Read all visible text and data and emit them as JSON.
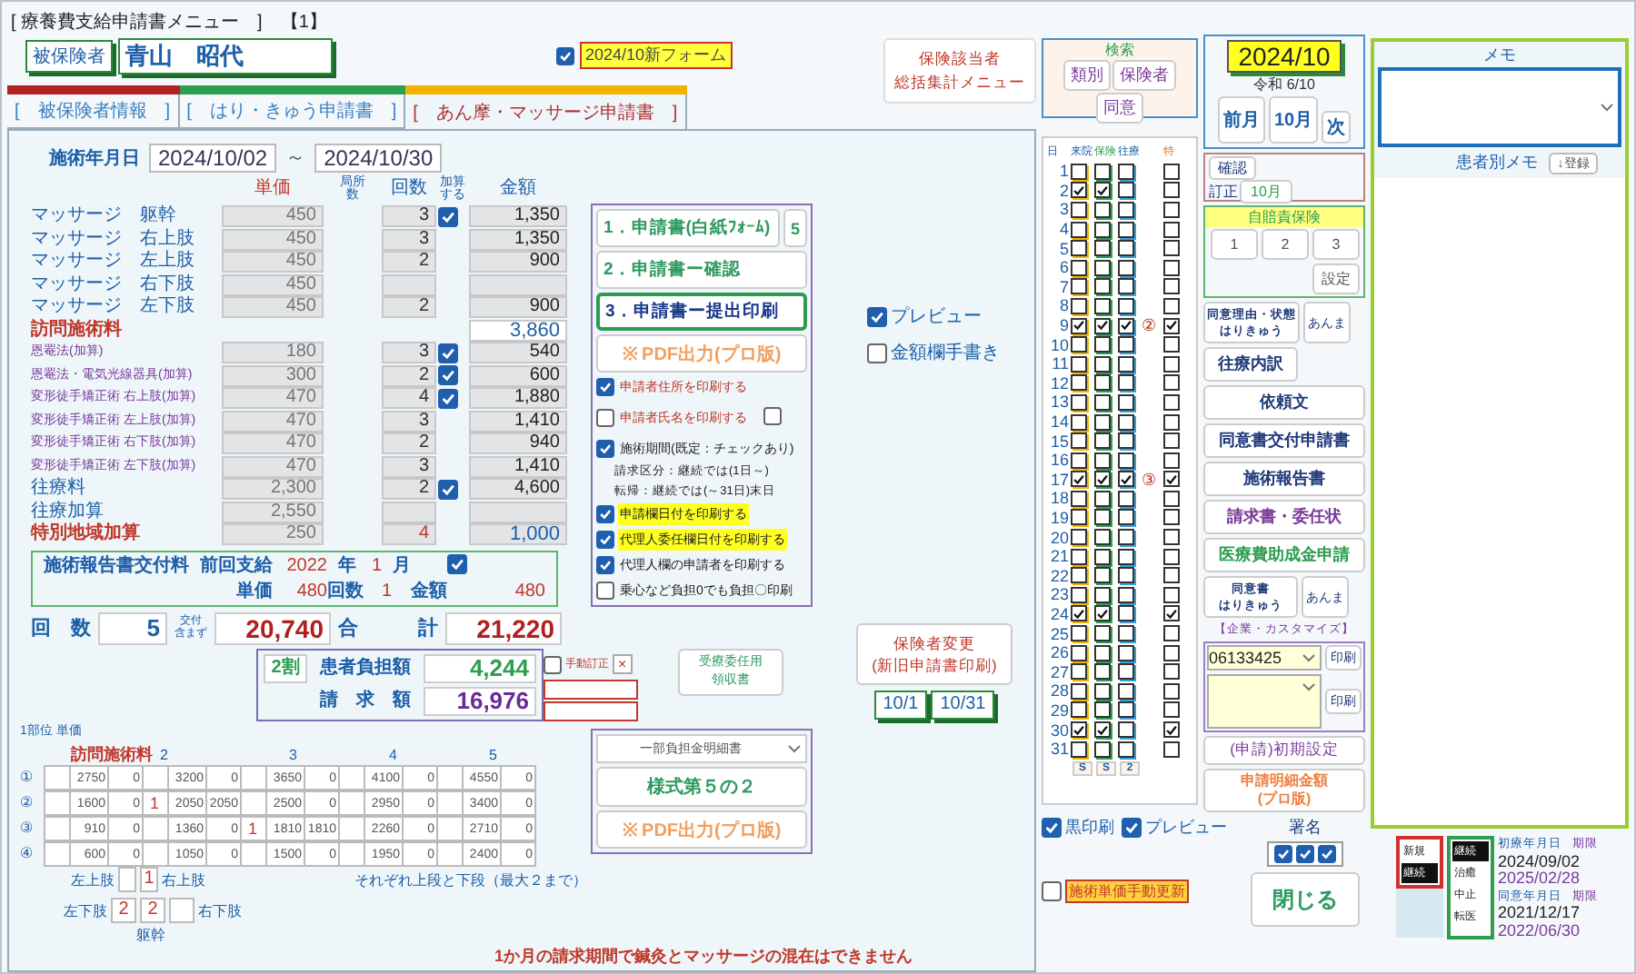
{
  "window": {
    "title": "[ 療養費支給申請書メニュー　]　【1】"
  },
  "insured": {
    "label": "被保険者",
    "name": "青山　昭代"
  },
  "new_form": {
    "label": "2024/10新フォーム",
    "checked": true
  },
  "tabs": [
    {
      "label": "[　被保険者情報　]",
      "selected": false,
      "color": "#b22222"
    },
    {
      "label": "[　はり・きゅう申請書　]",
      "selected": false,
      "color": "#2e9e4f"
    },
    {
      "label": "[　あん摩・マッサージ申請書　]",
      "selected": true,
      "color": "#f0b400"
    }
  ],
  "summary_button": [
    "保険該当者",
    "総括集計メニュー"
  ],
  "period": {
    "label": "施術年月日",
    "from": "2024/10/02",
    "separator": "～",
    "to": "2024/10/30"
  },
  "columns": {
    "price": [
      "単価"
    ],
    "sites": [
      "局所",
      "数"
    ],
    "count": [
      "回数"
    ],
    "add": [
      "加算",
      "する"
    ],
    "amount": [
      "金額"
    ]
  },
  "items": [
    {
      "kind": "massage",
      "label": "マッサージ　躯幹",
      "price": "450",
      "count": "3",
      "added": true,
      "amount": "1,350"
    },
    {
      "kind": "massage",
      "label": "マッサージ　右上肢",
      "price": "450",
      "count": "3",
      "added": false,
      "amount": "1,350"
    },
    {
      "kind": "massage",
      "label": "マッサージ　左上肢",
      "price": "450",
      "count": "2",
      "added": false,
      "amount": "900"
    },
    {
      "kind": "massage",
      "label": "マッサージ　右下肢",
      "price": "450",
      "added": false
    },
    {
      "kind": "massage",
      "label": "マッサージ　左下肢",
      "price": "450",
      "count": "2",
      "added": false,
      "amount": "900"
    },
    {
      "kind": "visit",
      "label": "訪問施術料",
      "added": false,
      "amount": "3,860"
    },
    {
      "kind": "addon",
      "label": "恩罨法(加算)",
      "price": "180",
      "count": "3",
      "added": true,
      "amount": "540"
    },
    {
      "kind": "addon",
      "label": "恩罨法・電気光線器具(加算)",
      "price": "300",
      "count": "2",
      "added": true,
      "amount": "600"
    },
    {
      "kind": "addon",
      "label": "変形徒手矯正術 右上肢(加算)",
      "price": "470",
      "count": "4",
      "added": true,
      "amount": "1,880"
    },
    {
      "kind": "addon",
      "label": "変形徒手矯正術 左上肢(加算)",
      "price": "470",
      "count": "3",
      "added": false,
      "amount": "1,410"
    },
    {
      "kind": "addon",
      "label": "変形徒手矯正術 右下肢(加算)",
      "price": "470",
      "count": "2",
      "added": false,
      "amount": "940"
    },
    {
      "kind": "addon",
      "label": "変形徒手矯正術 左下肢(加算)",
      "price": "470",
      "count": "3",
      "added": false,
      "amount": "1,410"
    },
    {
      "kind": "travel",
      "label": "往療料",
      "price": "2,300",
      "count": "2",
      "added": true,
      "amount": "4,600"
    },
    {
      "kind": "travel",
      "label": "往療加算",
      "price": "2,550",
      "added": false
    },
    {
      "kind": "special",
      "label": "特別地域加算",
      "price": "250",
      "count": "4",
      "added": false,
      "amount": "1,000"
    }
  ],
  "report_fee": {
    "label": "施術報告書交付料",
    "previous_label": "前回支給",
    "year": "2022",
    "year_unit": "年",
    "month": "1",
    "month_unit": "月",
    "checked": true,
    "price_label": "単価",
    "price": "480",
    "count_label": "回数",
    "count": "1",
    "amount_label": "金額",
    "amount": "480"
  },
  "totals": {
    "count_label": "回　数",
    "count": "5",
    "excl_label": [
      "交付",
      "含まず"
    ],
    "excl": "20,740",
    "total_label": "合　　　計",
    "total": "21,220"
  },
  "burden": {
    "ratio": "2割",
    "patient_label": "患者負担額",
    "patient": "4,244",
    "claim_label": "請　求　額",
    "claim": "16,976",
    "manual_label": "手動訂正",
    "manual_checked": false,
    "clear": "×"
  },
  "receipt_button": [
    "受療委任用",
    "領収書"
  ],
  "insurer_change_button": [
    "保険者変更",
    "(新旧申請書印刷)"
  ],
  "date_tags": [
    "10/1",
    "10/31"
  ],
  "print_buttons": [
    {
      "label": "1．申請書(白紙ﾌｫｰﾑ)",
      "selected": false
    },
    {
      "label": "2．申請書ー確認",
      "selected": false
    },
    {
      "label": "3．申請書ー提出印刷",
      "selected": true
    }
  ],
  "copies": "5",
  "pdf_button": "※ PDF出力(プロ版)",
  "print_options": [
    {
      "kind": "warn",
      "label": "申請者住所を印刷する",
      "checked": true
    },
    {
      "kind": "warn",
      "label": "申請者氏名を印刷する",
      "checked": false,
      "extra_checked": false
    },
    {
      "kind": "note",
      "label": "施術期間(既定：チェックあり)",
      "checked": true,
      "notes": [
        "請求区分：継続では(1日～)",
        "転帰：継続では(～31日)末日"
      ]
    },
    {
      "kind": "highlight",
      "label": "申請欄日付を印刷する",
      "checked": true
    },
    {
      "kind": "highlight",
      "label": "代理人委任欄日付を印刷する",
      "checked": true
    },
    {
      "kind": "plain",
      "label": "代理人欄の申請者を印刷する",
      "checked": true
    },
    {
      "kind": "plain",
      "label": "乗心など負担0でも負担〇印刷",
      "checked": false
    }
  ],
  "preview_options": [
    {
      "label": "プレビュー",
      "checked": true
    },
    {
      "label": "金額欄手書き",
      "checked": false
    }
  ],
  "detail": {
    "unit_label": "1部位 単価",
    "first_label": "訪問施術料",
    "group_labels": [
      "2",
      "3",
      "4",
      "5"
    ],
    "rows": [
      {
        "mark": "①",
        "cells": [
          [
            "",
            "2750",
            "0"
          ],
          [
            "",
            "3200",
            "0"
          ],
          [
            "",
            "3650",
            "0"
          ],
          [
            "",
            "4100",
            "0"
          ],
          [
            "",
            "4550",
            "0"
          ]
        ]
      },
      {
        "mark": "②",
        "cells": [
          [
            "",
            "1600",
            "0"
          ],
          [
            "1",
            "2050",
            "2050"
          ],
          [
            "",
            "2500",
            "0"
          ],
          [
            "",
            "2950",
            "0"
          ],
          [
            "",
            "3400",
            "0"
          ]
        ]
      },
      {
        "mark": "③",
        "cells": [
          [
            "",
            "910",
            "0"
          ],
          [
            "",
            "1360",
            "0"
          ],
          [
            "1",
            "1810",
            "1810"
          ],
          [
            "",
            "2260",
            "0"
          ],
          [
            "",
            "2710",
            "0"
          ]
        ]
      },
      {
        "mark": "④",
        "cells": [
          [
            "",
            "600",
            "0"
          ],
          [
            "",
            "1050",
            "0"
          ],
          [
            "",
            "1500",
            "0"
          ],
          [
            "",
            "1950",
            "0"
          ],
          [
            "",
            "2400",
            "0"
          ]
        ]
      }
    ],
    "note": "それぞれ上段と下段（最大２まで）",
    "upper": {
      "left": "左上肢",
      "right_value": "1",
      "right": "右上肢"
    },
    "lower": {
      "left": "左下肢",
      "left_value": "2",
      "middle_value": "2",
      "right": "右下肢"
    },
    "trunk": "躯幹"
  },
  "statement": {
    "select": "一部負担金明細書",
    "form_button": "様式第５の２",
    "pdf_button": "※ PDF出力(プロ版)"
  },
  "warning": "1か月の請求期間で鍼灸とマッサージの混在はできません",
  "search": {
    "title": "検索",
    "buttons": [
      "類別",
      "保険者",
      "同意"
    ]
  },
  "calendar": {
    "headers": [
      "日",
      "来院",
      "保険",
      "往療",
      "特"
    ],
    "days": [
      {
        "day": "1",
        "visit": false,
        "insured": false,
        "travel": false,
        "special": false
      },
      {
        "day": "2",
        "visit": true,
        "insured": true,
        "travel": false,
        "special": false
      },
      {
        "day": "3",
        "visit": false,
        "insured": false,
        "travel": false,
        "special": false
      },
      {
        "day": "4",
        "visit": false,
        "insured": false,
        "travel": false,
        "special": false
      },
      {
        "day": "5",
        "visit": false,
        "insured": false,
        "travel": false,
        "special": false
      },
      {
        "day": "6",
        "visit": false,
        "insured": false,
        "travel": false,
        "special": false
      },
      {
        "day": "7",
        "visit": false,
        "insured": false,
        "travel": false,
        "special": false
      },
      {
        "day": "8",
        "visit": false,
        "insured": false,
        "travel": false,
        "special": false
      },
      {
        "day": "9",
        "visit": true,
        "insured": true,
        "travel": true,
        "badge": "②",
        "special": true
      },
      {
        "day": "10",
        "visit": false,
        "insured": false,
        "travel": false,
        "special": false
      },
      {
        "day": "11",
        "visit": false,
        "insured": false,
        "travel": false,
        "special": false
      },
      {
        "day": "12",
        "visit": false,
        "insured": false,
        "travel": false,
        "special": false
      },
      {
        "day": "13",
        "visit": false,
        "insured": false,
        "travel": false,
        "special": false
      },
      {
        "day": "14",
        "visit": false,
        "insured": false,
        "travel": false,
        "special": false
      },
      {
        "day": "15",
        "visit": false,
        "insured": false,
        "travel": false,
        "special": false
      },
      {
        "day": "16",
        "visit": false,
        "insured": false,
        "travel": false,
        "special": false
      },
      {
        "day": "17",
        "visit": true,
        "insured": true,
        "travel": true,
        "badge": "③",
        "special": true
      },
      {
        "day": "18",
        "visit": false,
        "insured": false,
        "travel": false,
        "special": false
      },
      {
        "day": "19",
        "visit": false,
        "insured": false,
        "travel": false,
        "special": false
      },
      {
        "day": "20",
        "visit": false,
        "insured": false,
        "travel": false,
        "special": false
      },
      {
        "day": "21",
        "visit": false,
        "insured": false,
        "travel": false,
        "special": false
      },
      {
        "day": "22",
        "visit": false,
        "insured": false,
        "travel": false,
        "special": false
      },
      {
        "day": "23",
        "visit": false,
        "insured": false,
        "travel": false,
        "special": false
      },
      {
        "day": "24",
        "visit": true,
        "insured": true,
        "travel": false,
        "special": true
      },
      {
        "day": "25",
        "visit": false,
        "insured": false,
        "travel": false,
        "special": false
      },
      {
        "day": "26",
        "visit": false,
        "insured": false,
        "travel": false,
        "special": false
      },
      {
        "day": "27",
        "visit": false,
        "insured": false,
        "travel": false,
        "special": false
      },
      {
        "day": "28",
        "visit": false,
        "insured": false,
        "travel": false,
        "special": false
      },
      {
        "day": "29",
        "visit": false,
        "insured": false,
        "travel": false,
        "special": false
      },
      {
        "day": "30",
        "visit": true,
        "insured": true,
        "travel": false,
        "special": true
      },
      {
        "day": "31",
        "visit": false,
        "insured": false,
        "travel": false,
        "special": false
      }
    ],
    "footer": [
      "S",
      "S",
      "2"
    ]
  },
  "month": {
    "value": "2024/10",
    "era": "令和 6/10",
    "prev": "前月",
    "current": "10月",
    "next": "次"
  },
  "confirm": {
    "confirm": "確認",
    "correct": "訂正",
    "month": "10月"
  },
  "auto_insurance": {
    "title": "自賠責保険",
    "buttons": [
      "1",
      "2",
      "3"
    ],
    "setting": "設定"
  },
  "doc_buttons": [
    {
      "kind": "split",
      "lines": [
        "同意理由・状態",
        "はりきゅう"
      ],
      "side": "あんま",
      "color": "#1f3a7a"
    },
    {
      "kind": "half",
      "lines": [
        "往療内訳"
      ],
      "color": "#1f3a7a"
    },
    {
      "kind": "full",
      "lines": [
        "依頼文"
      ],
      "color": "#1f3a7a"
    },
    {
      "kind": "full",
      "lines": [
        "同意書交付申請書"
      ],
      "color": "#1f3a7a"
    },
    {
      "kind": "full",
      "lines": [
        "施術報告書"
      ],
      "color": "#1f3a7a"
    },
    {
      "kind": "full",
      "lines": [
        "請求書・委任状"
      ],
      "color": "#7a3a9a"
    },
    {
      "kind": "full",
      "lines": [
        "医療費助成金申請"
      ],
      "color": "#2e9e4f"
    },
    {
      "kind": "split",
      "lines": [
        "同意書",
        "はりきゅう"
      ],
      "side": "あんま",
      "color": "#1f3a7a"
    }
  ],
  "custom": {
    "title": "【企業・カスタマイズ】",
    "rows": [
      {
        "value": "06133425",
        "button": "印刷"
      },
      {
        "button": "印刷"
      }
    ]
  },
  "settings_button": "(申請)初期設定",
  "amount_button": [
    "申請明細金額",
    "(プロ版)"
  ],
  "bottom_options": [
    {
      "label": "黒印刷",
      "checked": true
    },
    {
      "label": "プレビュー",
      "checked": true
    }
  ],
  "signature": {
    "label": "署名",
    "checks": [
      true,
      true,
      true
    ]
  },
  "manual_update": {
    "label": "施術単価手動更新",
    "checked": false
  },
  "close_button": "閉じる",
  "memo": {
    "title": "メモ",
    "patient_memo": "患者別メモ",
    "register": "↓登録"
  },
  "status": {
    "type": [
      {
        "label": "新規",
        "selected": false
      },
      {
        "label": "継続",
        "selected": true
      }
    ],
    "outcome": [
      {
        "label": "継続",
        "selected": true
      },
      {
        "label": "治癒",
        "selected": false
      },
      {
        "label": "中止",
        "selected": false
      },
      {
        "label": "転医",
        "selected": false
      }
    ]
  },
  "dates": {
    "first_label": "初療年月日",
    "first_limit_label": "期限",
    "first": "2024/09/02",
    "first_limit": "2025/02/28",
    "consent_label": "同意年月日",
    "consent_limit_label": "期限",
    "consent": "2021/12/17",
    "consent_limit": "2022/06/30"
  }
}
